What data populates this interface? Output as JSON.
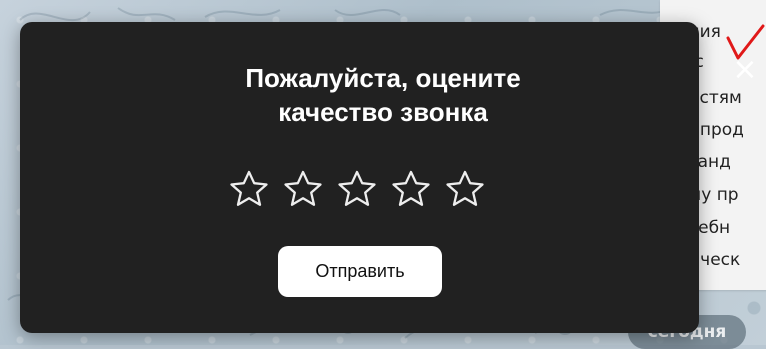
{
  "background_chat": {
    "lines": [
      "ения",
      "и с",
      "ностям",
      "й, прод",
      "ксанд",
      "ому пр",
      "учебн",
      "ническ"
    ],
    "date_label": "сегодня"
  },
  "modal": {
    "title": "Пожалуйста, оцените качество звонка",
    "rating": {
      "max": 5,
      "selected": 0,
      "stars": [
        "star-1",
        "star-2",
        "star-3",
        "star-4",
        "star-5"
      ]
    },
    "submit_label": "Отправить",
    "close_icon": "close-icon"
  },
  "colors": {
    "modal_bg": "#212121",
    "text": "#ffffff",
    "button_bg": "#ffffff",
    "annotation": "#e01818"
  }
}
